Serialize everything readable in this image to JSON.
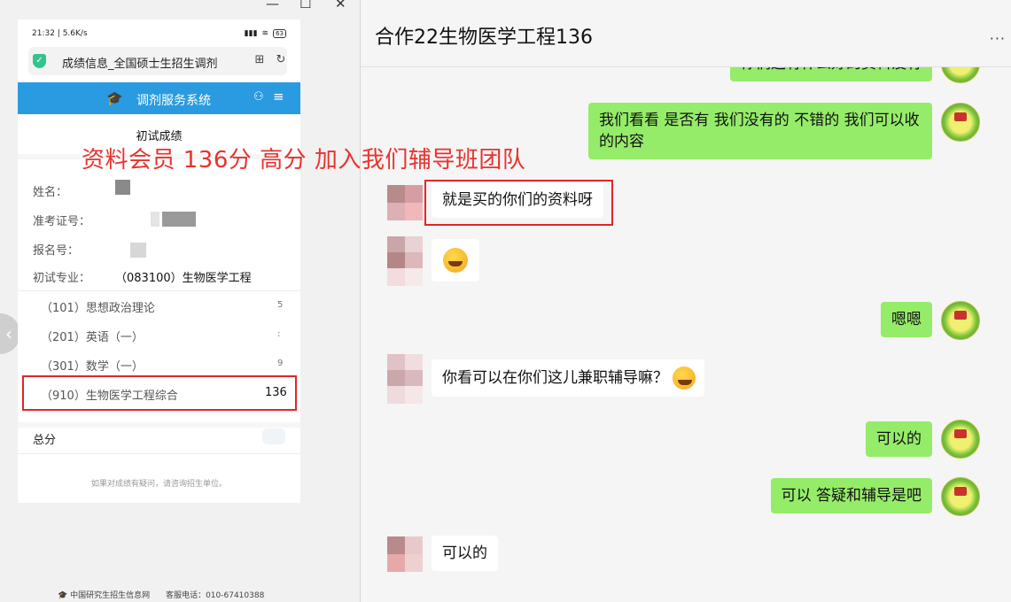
{
  "window_controls": {
    "minimize": "—",
    "maximize": "☐",
    "close": "✕"
  },
  "phone": {
    "status_time": "21:32 | 5.6K/s",
    "status_signal": "▮▮▮",
    "status_wifi": "≋",
    "battery": "63",
    "url": "成绩信息_全国硕士生招生调剂",
    "site_title": "调剂服务系统",
    "section_title": "初试成绩",
    "labels": {
      "name": "姓名：",
      "exam_id": "准考证号：",
      "reg_id": "报名号：",
      "major": "初试专业："
    },
    "major_value": "（083100）生物医学工程",
    "subjects": [
      {
        "name": "（101）思想政治理论",
        "score": "5"
      },
      {
        "name": "（201）英语（一）",
        "score": ":"
      },
      {
        "name": "（301）数学（一）",
        "score": "9"
      },
      {
        "name": "（910）生物医学工程综合",
        "score": "136"
      }
    ],
    "total_label": "总分",
    "footnote": "如果对成绩有疑问，请咨询招生单位。",
    "bottom_footer": "中国研究生招生信息网　　客服电话：010-67410388"
  },
  "overlay_text": "资料会员 136分 高分 加入我们辅导班团队",
  "chat": {
    "title": "合作22生物医学工程136",
    "more": "···",
    "messages": [
      {
        "dir": "out",
        "text": "你们这有什么好的资料没有"
      },
      {
        "dir": "out",
        "text": "我们看看 是否有 我们没有的 不错的 我们可以收的内容"
      },
      {
        "dir": "in",
        "text": "就是买的你们的资料呀"
      },
      {
        "dir": "in",
        "text": "",
        "emoji": "laugh-cry"
      },
      {
        "dir": "out",
        "text": "嗯嗯"
      },
      {
        "dir": "in",
        "text": "你看可以在你们这儿兼职辅导嘛？",
        "emoji": "laugh-cry"
      },
      {
        "dir": "out",
        "text": "可以的"
      },
      {
        "dir": "out",
        "text": "可以 答疑和辅导是吧"
      },
      {
        "dir": "in",
        "text": "可以的"
      }
    ]
  },
  "colors": {
    "outgoing_bubble": "#95ec69",
    "site_blue": "#2a9be0",
    "highlight_red": "#e0262b"
  }
}
